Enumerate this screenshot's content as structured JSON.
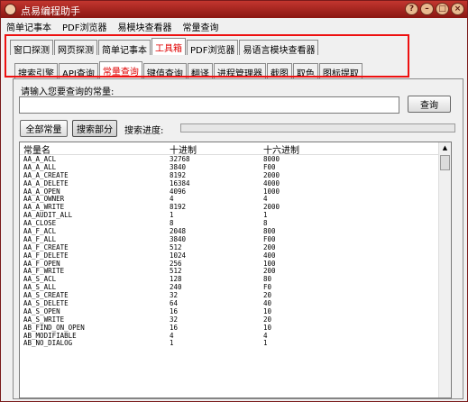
{
  "window": {
    "title": "点易编程助手"
  },
  "menu": [
    "简单记事本",
    "PDF浏览器",
    "易模块查看器",
    "常量查询"
  ],
  "tabs_top": [
    {
      "label": "窗口探测"
    },
    {
      "label": "网页探测"
    },
    {
      "label": "简单记事本"
    },
    {
      "label": "工具箱"
    },
    {
      "label": "PDF浏览器"
    },
    {
      "label": "易语言模块查看器"
    }
  ],
  "tabs_sub": [
    {
      "label": "搜索引擎"
    },
    {
      "label": "API查询"
    },
    {
      "label": "常量查询"
    },
    {
      "label": "键值查询"
    },
    {
      "label": "翻译"
    },
    {
      "label": "进程管理器"
    },
    {
      "label": "截图"
    },
    {
      "label": "取色"
    },
    {
      "label": "图标提取"
    }
  ],
  "query": {
    "prompt": "请输入您要查询的常量:",
    "value": "",
    "button": "查询"
  },
  "actions": {
    "all": "全部常量",
    "partial": "搜索部分",
    "progress_label": "搜索进度:",
    "progress": 0
  },
  "table": {
    "columns": [
      "常量名",
      "十进制",
      "十六进制"
    ],
    "rows": [
      [
        "AA_A_ACL",
        "32768",
        "8000"
      ],
      [
        "AA_A_ALL",
        "3840",
        "F00"
      ],
      [
        "AA_A_CREATE",
        "8192",
        "2000"
      ],
      [
        "AA_A_DELETE",
        "16384",
        "4000"
      ],
      [
        "AA_A_OPEN",
        "4096",
        "1000"
      ],
      [
        "AA_A_OWNER",
        "4",
        "4"
      ],
      [
        "AA_A_WRITE",
        "8192",
        "2000"
      ],
      [
        "AA_AUDIT_ALL",
        "1",
        "1"
      ],
      [
        "AA_CLOSE",
        "8",
        "8"
      ],
      [
        "AA_F_ACL",
        "2048",
        "800"
      ],
      [
        "AA_F_ALL",
        "3840",
        "F00"
      ],
      [
        "AA_F_CREATE",
        "512",
        "200"
      ],
      [
        "AA_F_DELETE",
        "1024",
        "400"
      ],
      [
        "AA_F_OPEN",
        "256",
        "100"
      ],
      [
        "AA_F_WRITE",
        "512",
        "200"
      ],
      [
        "AA_S_ACL",
        "128",
        "80"
      ],
      [
        "AA_S_ALL",
        "240",
        "F0"
      ],
      [
        "AA_S_CREATE",
        "32",
        "20"
      ],
      [
        "AA_S_DELETE",
        "64",
        "40"
      ],
      [
        "AA_S_OPEN",
        "16",
        "10"
      ],
      [
        "AA_S_WRITE",
        "32",
        "20"
      ],
      [
        "AB_FIND_ON_OPEN",
        "16",
        "10"
      ],
      [
        "AB_MODIFIABLE",
        "4",
        "4"
      ],
      [
        "AB_NO_DIALOG",
        "1",
        "1"
      ]
    ]
  }
}
